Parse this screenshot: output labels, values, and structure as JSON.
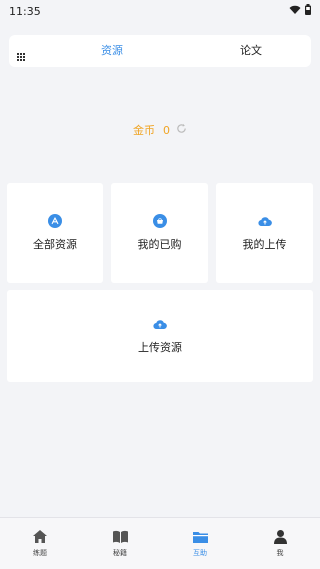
{
  "status_bar": {
    "time": "11:35"
  },
  "tabs": {
    "resources": "资源",
    "papers": "论文"
  },
  "coins": {
    "label": "金币",
    "value": "0"
  },
  "cards": [
    {
      "label": "全部资源",
      "icon": "app-store-icon"
    },
    {
      "label": "我的已购",
      "icon": "basket-icon"
    },
    {
      "label": "我的上传",
      "icon": "cloud-upload-icon"
    },
    {
      "label": "上传资源",
      "icon": "cloud-upload-icon"
    }
  ],
  "nav": [
    {
      "label": "练题",
      "icon": "home-icon"
    },
    {
      "label": "秘籍",
      "icon": "book-icon"
    },
    {
      "label": "互助",
      "icon": "folder-icon"
    },
    {
      "label": "我",
      "icon": "user-icon"
    }
  ],
  "colors": {
    "accent": "#3a8ee6",
    "coin": "#f0a526",
    "background": "#f3f4f7"
  }
}
